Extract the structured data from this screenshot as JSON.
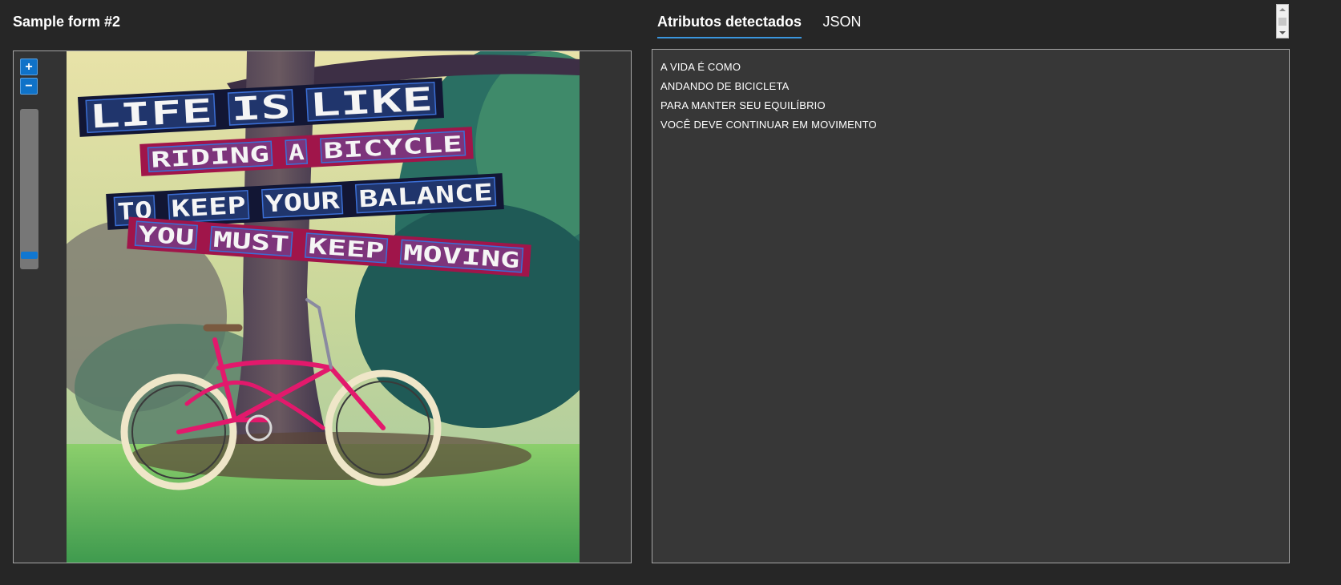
{
  "header": {
    "title": "Sample form #2"
  },
  "viewer": {
    "zoom_in_label": "+",
    "zoom_out_label": "−",
    "zoom_level": 0.08,
    "image": {
      "sign_lines": [
        [
          "LIFE",
          "IS",
          "LIKE"
        ],
        [
          "RIDING",
          "A",
          "BICYCLE"
        ],
        [
          "TO",
          "KEEP",
          "YOUR",
          "BALANCE"
        ],
        [
          "YOU",
          "MUST",
          "KEEP",
          "MOVING"
        ]
      ],
      "colors": {
        "dark_strip": "#121634",
        "pink_strip": "#a0154a",
        "bike": "#e2196c",
        "highlight": "#3b6fd6"
      }
    }
  },
  "tabs": [
    {
      "label": "Atributos detectados",
      "active": true
    },
    {
      "label": "JSON",
      "active": false
    }
  ],
  "attributes": {
    "lines": [
      "A VIDA É COMO",
      "ANDANDO DE BICICLETA",
      "PARA MANTER SEU EQUILÍBRIO",
      "VOCÊ DEVE CONTINUAR EM MOVIMENTO"
    ]
  },
  "colors": {
    "background": "#262626",
    "panel": "#373737",
    "accent": "#1177d1"
  }
}
